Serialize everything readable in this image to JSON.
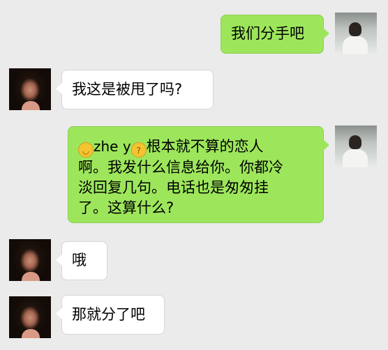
{
  "messages": [
    {
      "side": "right",
      "text": "我们分手吧"
    },
    {
      "side": "left",
      "text": "我这是被甩了吗?"
    },
    {
      "side": "right",
      "emoji_left": "grinning-sweat-icon",
      "name": "zhe y",
      "emoji_right": "thinking-face-icon",
      "lines": [
        "根本就不算的恋人",
        "啊。我发什么信息给你。你都冷",
        "淡回复几句。电话也是匆匆挂",
        "了。这算什么?"
      ]
    },
    {
      "side": "left",
      "text": "哦"
    },
    {
      "side": "left",
      "text": "那就分了吧"
    }
  ],
  "colors": {
    "background": "#ebebeb",
    "bubble_self": "#9de65c",
    "bubble_other": "#ffffff"
  }
}
